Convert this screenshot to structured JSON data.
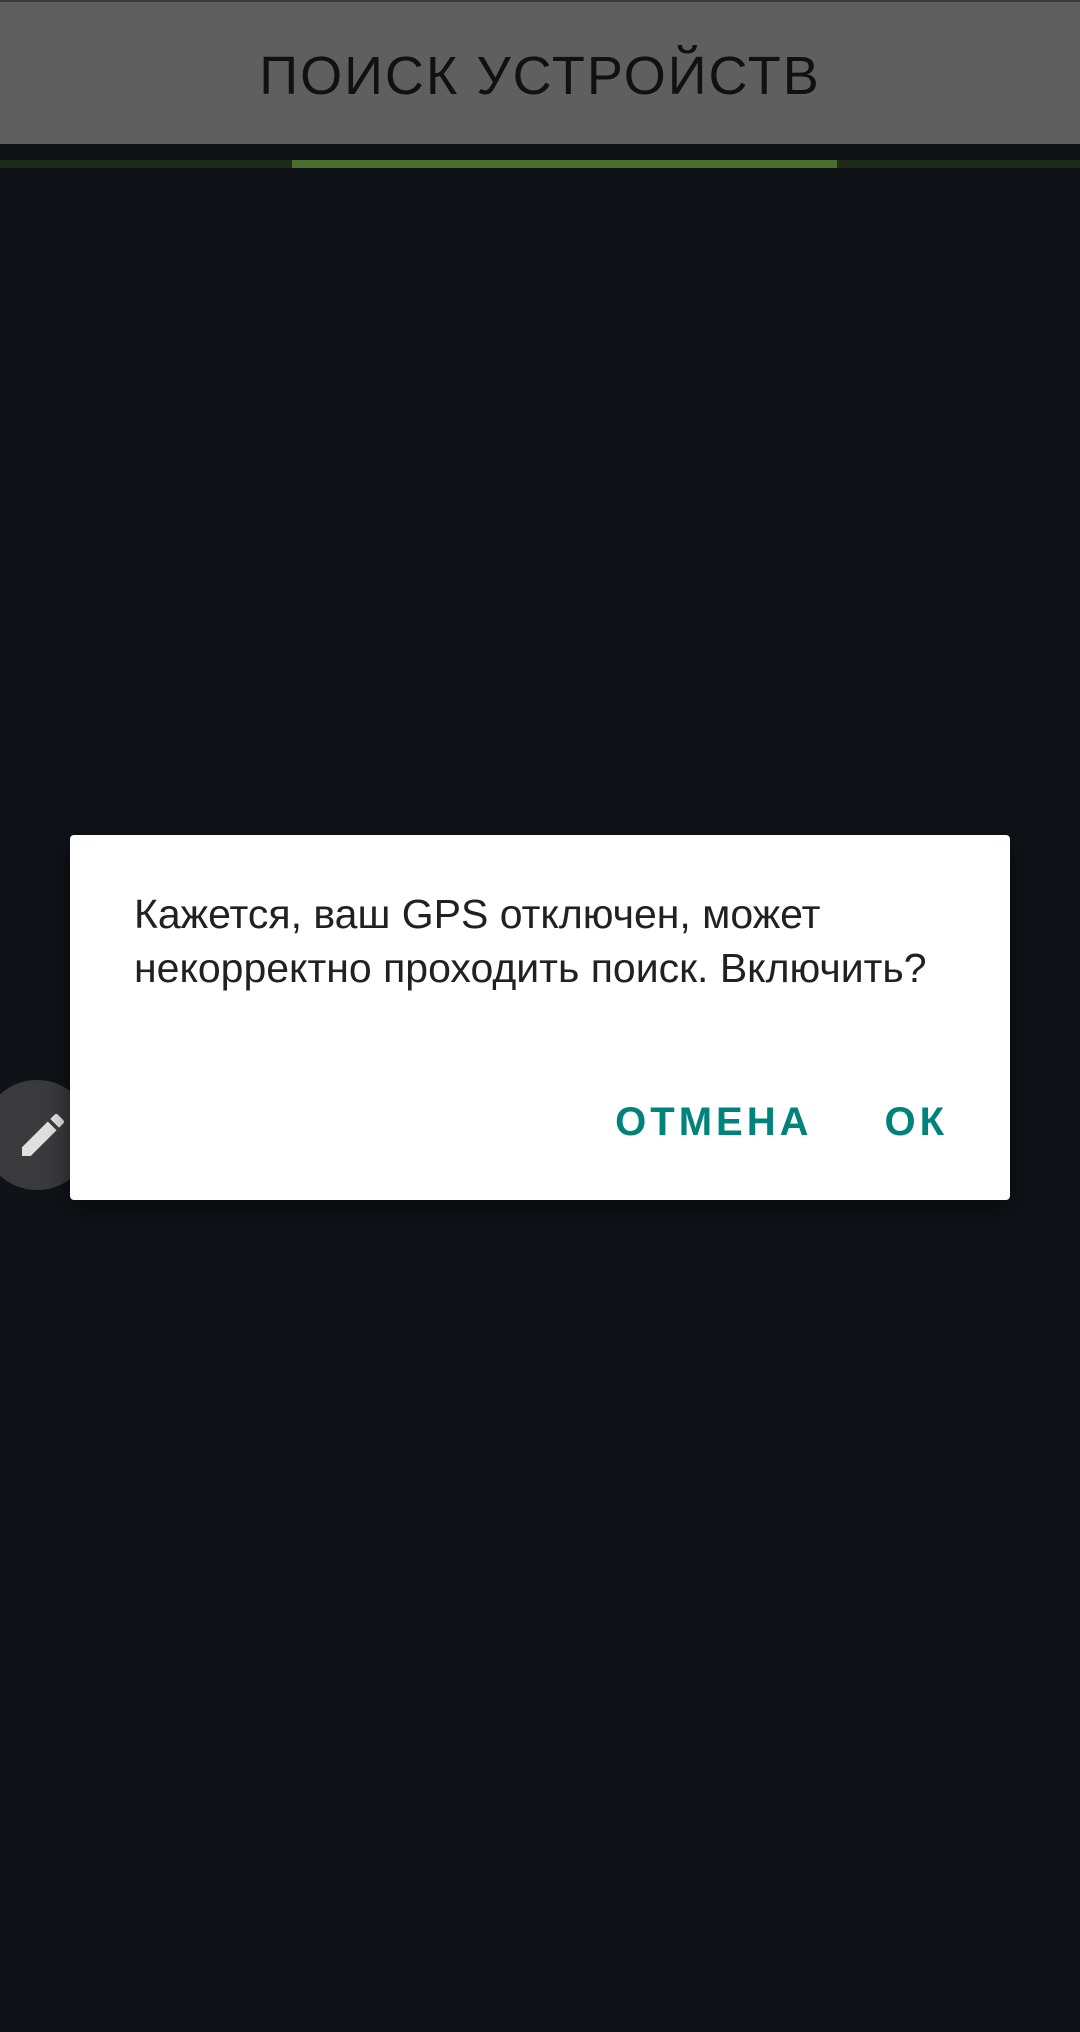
{
  "header": {
    "title": "ПОИСК УСТРОЙСТВ"
  },
  "progress": {
    "start_fraction": 0.27,
    "end_fraction": 0.775,
    "color": "#4a6e2c"
  },
  "fab": {
    "icon": "pencil-icon"
  },
  "dialog": {
    "message": "Кажется, ваш GPS отключен, может некорректно проходить поиск. Включить?",
    "cancel_label": "ОТМЕНА",
    "ok_label": "ОК",
    "accent_color": "#00837a"
  }
}
